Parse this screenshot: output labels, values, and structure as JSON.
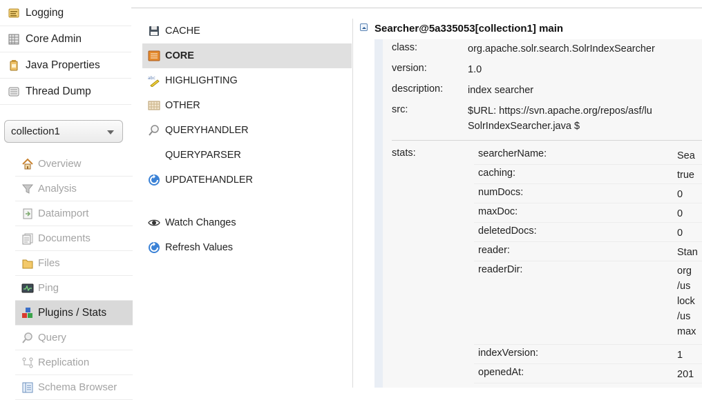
{
  "sidebar": {
    "admin_items": [
      {
        "label": "Logging",
        "icon": "logging-icon"
      },
      {
        "label": "Core Admin",
        "icon": "core-admin-icon"
      },
      {
        "label": "Java Properties",
        "icon": "java-properties-icon"
      },
      {
        "label": "Thread Dump",
        "icon": "thread-dump-icon"
      }
    ],
    "core_selector": {
      "value": "collection1"
    },
    "core_menu": [
      {
        "label": "Overview",
        "icon": "overview-icon"
      },
      {
        "label": "Analysis",
        "icon": "analysis-icon"
      },
      {
        "label": "Dataimport",
        "icon": "dataimport-icon"
      },
      {
        "label": "Documents",
        "icon": "documents-icon"
      },
      {
        "label": "Files",
        "icon": "files-icon"
      },
      {
        "label": "Ping",
        "icon": "ping-icon"
      },
      {
        "label": "Plugins / Stats",
        "icon": "plugins-icon",
        "active": true
      },
      {
        "label": "Query",
        "icon": "query-icon"
      },
      {
        "label": "Replication",
        "icon": "replication-icon"
      },
      {
        "label": "Schema Browser",
        "icon": "schema-browser-icon"
      }
    ]
  },
  "categories": {
    "items": [
      {
        "label": "CACHE",
        "icon": "floppy-disk-icon"
      },
      {
        "label": "CORE",
        "icon": "core-box-icon",
        "active": true
      },
      {
        "label": "HIGHLIGHTING",
        "icon": "highlighter-icon"
      },
      {
        "label": "OTHER",
        "icon": "grid-icon"
      },
      {
        "label": "QUERYHANDLER",
        "icon": "magnifier-icon"
      },
      {
        "label": "QUERYPARSER",
        "icon": ""
      },
      {
        "label": "UPDATEHANDLER",
        "icon": "refresh-icon"
      }
    ],
    "actions": [
      {
        "label": "Watch Changes",
        "icon": "eye-icon"
      },
      {
        "label": "Refresh Values",
        "icon": "refresh-icon"
      }
    ]
  },
  "detail": {
    "title": "Searcher@5a335053[collection1] main",
    "fields": [
      {
        "key": "class:",
        "value": "org.apache.solr.search.SolrIndexSearcher"
      },
      {
        "key": "version:",
        "value": "1.0"
      },
      {
        "key": "description:",
        "value": "index searcher"
      },
      {
        "key": "src:",
        "value": "$URL: https://svn.apache.org/repos/asf/lu",
        "value2": "SolrIndexSearcher.java $"
      }
    ],
    "stats_label": "stats:",
    "stats": [
      {
        "key": "searcherName:",
        "value": "Sea"
      },
      {
        "key": "caching:",
        "value": "true"
      },
      {
        "key": "numDocs:",
        "value": "0"
      },
      {
        "key": "maxDoc:",
        "value": "0"
      },
      {
        "key": "deletedDocs:",
        "value": "0"
      },
      {
        "key": "reader:",
        "value": "Stan"
      },
      {
        "key": "readerDir:",
        "lines": [
          "org",
          "/us",
          "lock",
          "/us",
          "max"
        ]
      },
      {
        "key": "indexVersion:",
        "value": "1"
      },
      {
        "key": "openedAt:",
        "value": "201"
      }
    ]
  }
}
